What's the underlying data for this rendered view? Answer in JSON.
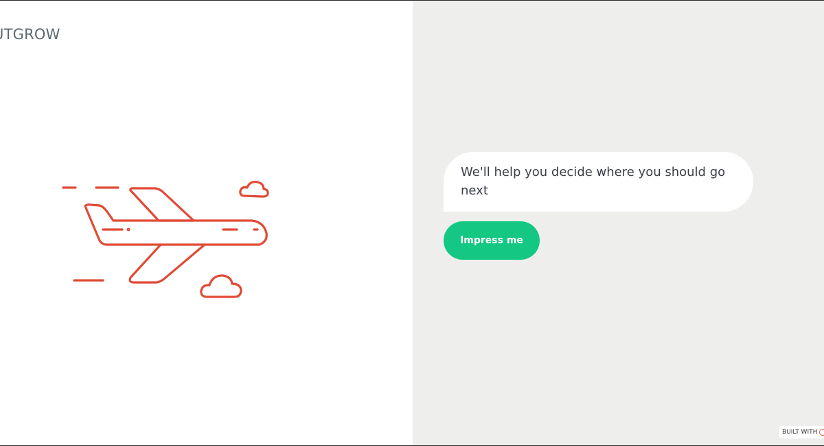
{
  "brand": {
    "logo_text": "UTGROW"
  },
  "illustration": {
    "icon": "airplane-icon",
    "accent_color": "#e04a35"
  },
  "chat": {
    "message": "We'll help you decide where you should go next",
    "cta_label": "Impress me",
    "cta_color": "#14c782"
  },
  "footer": {
    "built_with": "BUILT WITH"
  },
  "colors": {
    "left_bg": "#ffffff",
    "right_bg": "#eeeeec",
    "text": "#3a3e47"
  }
}
